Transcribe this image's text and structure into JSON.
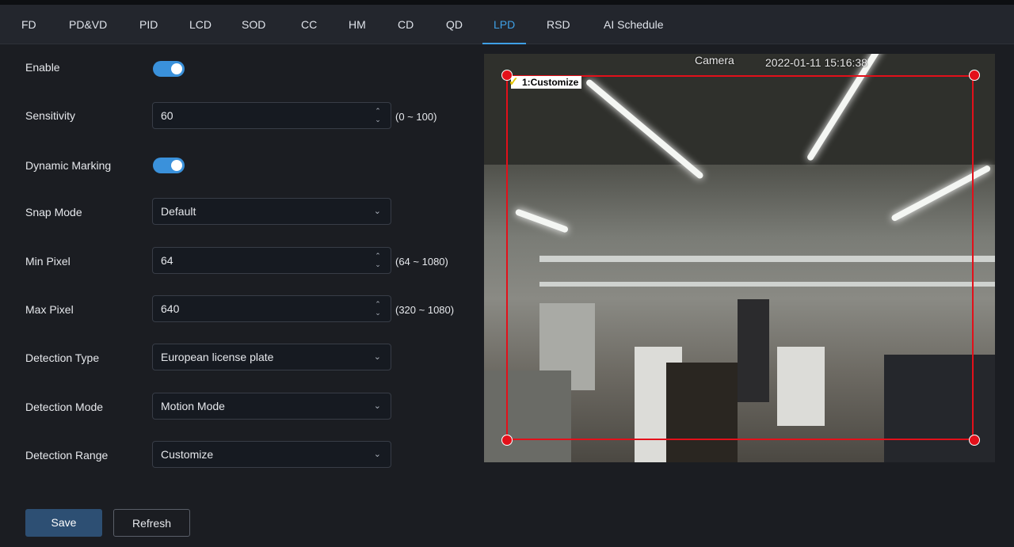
{
  "tabs": [
    {
      "label": "FD"
    },
    {
      "label": "PD&VD"
    },
    {
      "label": "PID"
    },
    {
      "label": "LCD"
    },
    {
      "label": "SOD"
    },
    {
      "label": "CC"
    },
    {
      "label": "HM"
    },
    {
      "label": "CD"
    },
    {
      "label": "QD"
    },
    {
      "label": "LPD"
    },
    {
      "label": "RSD"
    },
    {
      "label": "AI Schedule"
    }
  ],
  "active_tab": "LPD",
  "accent_color": "#3fa0e6",
  "form": {
    "enable": {
      "label": "Enable",
      "on": true
    },
    "sensitivity": {
      "label": "Sensitivity",
      "value": "60",
      "range": "(0 ~ 100)"
    },
    "dynamic_marking": {
      "label": "Dynamic Marking",
      "on": true
    },
    "snap_mode": {
      "label": "Snap Mode",
      "value": "Default"
    },
    "min_pixel": {
      "label": "Min Pixel",
      "value": "64",
      "range": "(64 ~ 1080)"
    },
    "max_pixel": {
      "label": "Max Pixel",
      "value": "640",
      "range": "(320 ~ 1080)"
    },
    "detection_type": {
      "label": "Detection Type",
      "value": "European license plate"
    },
    "detection_mode": {
      "label": "Detection Mode",
      "value": "Motion Mode"
    },
    "detection_range": {
      "label": "Detection Range",
      "value": "Customize"
    }
  },
  "buttons": {
    "save": "Save",
    "refresh": "Refresh"
  },
  "preview": {
    "camera_name": "Camera",
    "timestamp": "2022-01-11 15:16:38",
    "region_label": "1:Customize",
    "region_color": "#e3101a"
  }
}
